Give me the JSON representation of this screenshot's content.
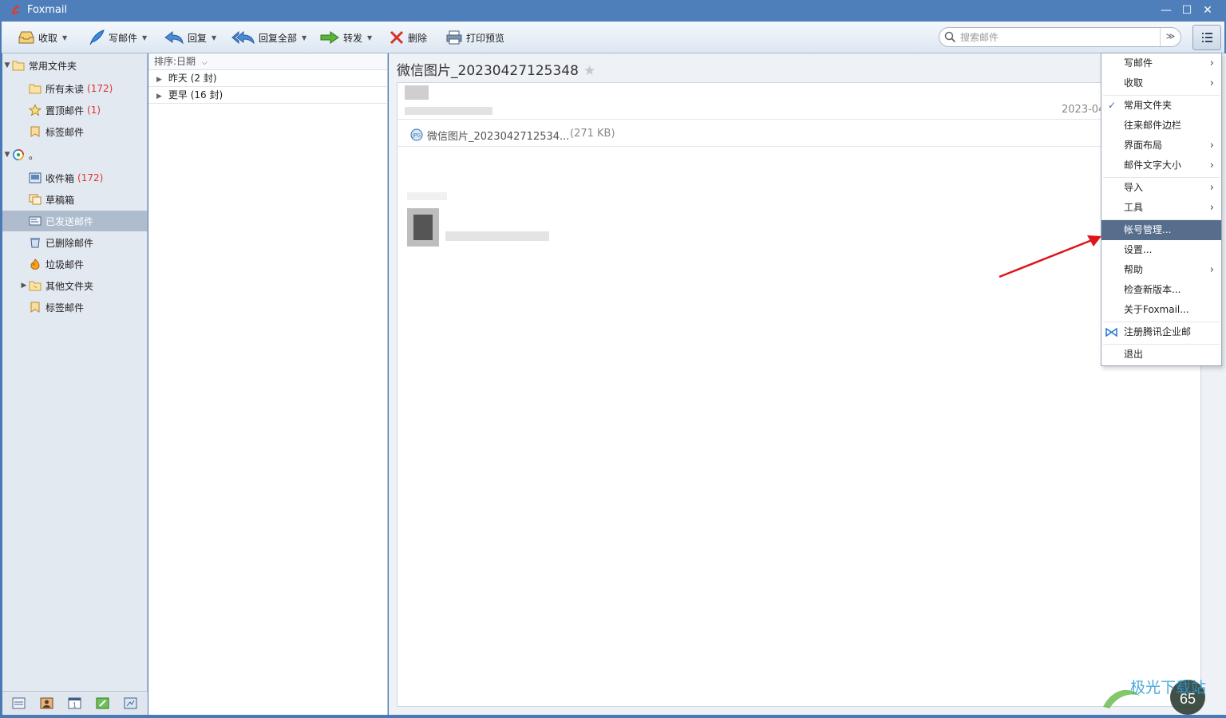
{
  "window": {
    "title": "Foxmail"
  },
  "toolbar": {
    "receive": "收取",
    "compose": "写邮件",
    "reply": "回复",
    "reply_all": "回复全部",
    "forward": "转发",
    "delete": "删除",
    "print_preview": "打印预览",
    "search_placeholder": "搜索邮件"
  },
  "sidebar": {
    "common_folder": "常用文件夹",
    "all_unread": "所有未读",
    "all_unread_count": "(172)",
    "pinned": "置顶邮件",
    "pinned_count": "(1)",
    "tagged": "标签邮件",
    "account": "。",
    "inbox": "收件箱",
    "inbox_count": "(172)",
    "drafts": "草稿箱",
    "sent": "已发送邮件",
    "deleted": "已删除邮件",
    "junk": "垃圾邮件",
    "other_folders": "其他文件夹",
    "tagged2": "标签邮件"
  },
  "maillist": {
    "sort_label": "排序:日期",
    "groups": [
      "昨天 (2 封)",
      "更早 (16 封)"
    ]
  },
  "reader": {
    "subject": "微信图片_20230427125348",
    "date": "2023-04",
    "attachment_name": "微信图片_2023042712534...",
    "attachment_size": "(271 KB)"
  },
  "menu": {
    "compose": "写邮件",
    "receive": "收取",
    "common_folders": "常用文件夹",
    "contacts_sidebar": "往来邮件边栏",
    "layout": "界面布局",
    "font_size": "邮件文字大小",
    "import": "导入",
    "tools": "工具",
    "account_mgmt": "帐号管理...",
    "settings": "设置...",
    "help": "帮助",
    "check_update": "检查新版本...",
    "about": "关于Foxmail...",
    "register": "注册腾讯企业邮",
    "exit": "退出"
  },
  "watermark": {
    "text": "极光下载站",
    "badge": "65"
  },
  "colors": {
    "titlebar": "#4f7fba",
    "selected": "#aebccd",
    "highlight": "#566d8c",
    "unread": "#e0332d",
    "arrow": "#e0151a"
  }
}
